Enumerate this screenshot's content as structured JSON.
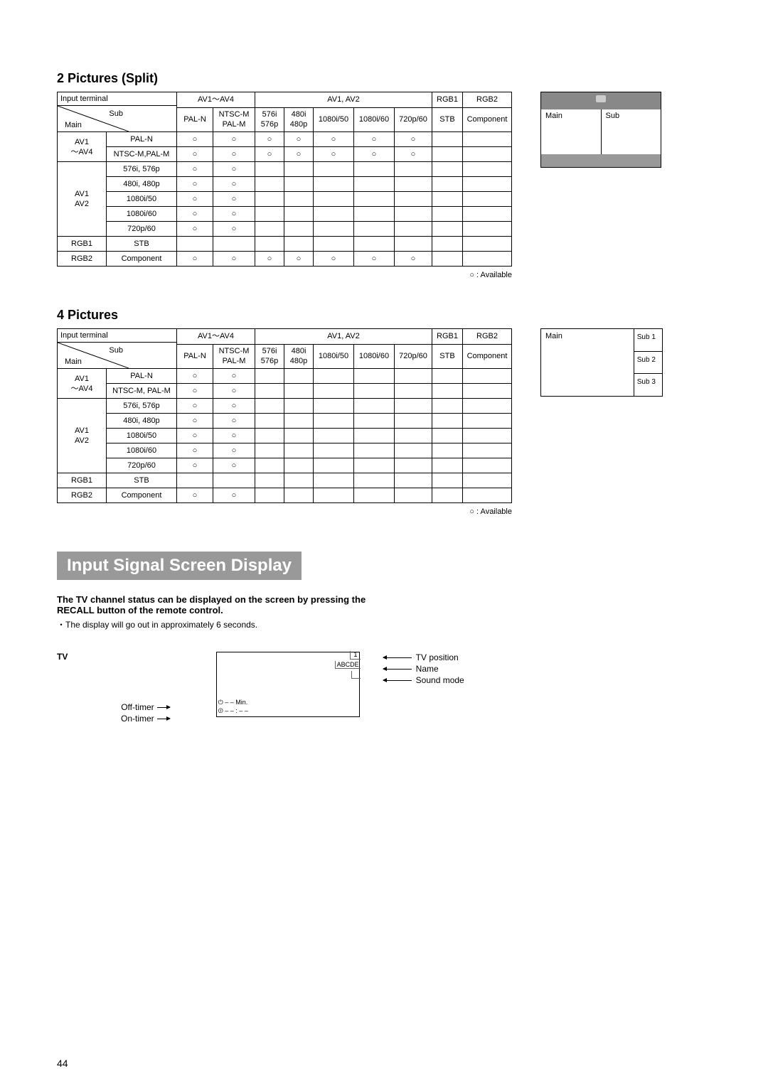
{
  "sectionA": {
    "title": "2 Pictures (Split)",
    "cols": {
      "input_terminal": "Input terminal",
      "group1": "AV1～AV4",
      "group2": "AV1, AV2",
      "rgb1": "RGB1",
      "rgb2": "RGB2",
      "sub": "Sub",
      "main": "Main",
      "pal_n": "PAL-N",
      "ntsc": "NTSC-M\nPAL-M",
      "c576i": "576i\n576p",
      "c480i": "480i\n480p",
      "c1080i50": "1080i/50",
      "c1080i60": "1080i/60",
      "c720p60": "720p/60",
      "stb": "STB",
      "component": "Component"
    },
    "rowGroups": {
      "g1": "AV1\n～AV4",
      "g2": "AV1\nAV2",
      "rgb1": "RGB1",
      "rgb2": "RGB2"
    },
    "rows": [
      {
        "label": "PAL-N",
        "cells": [
          "○",
          "○",
          "○",
          "○",
          "○",
          "○",
          "○",
          "",
          ""
        ]
      },
      {
        "label": "NTSC-M,PAL-M",
        "cells": [
          "○",
          "○",
          "○",
          "○",
          "○",
          "○",
          "○",
          "",
          ""
        ]
      },
      {
        "label": "576i, 576p",
        "cells": [
          "○",
          "○",
          "",
          "",
          "",
          "",
          "",
          "",
          ""
        ]
      },
      {
        "label": "480i, 480p",
        "cells": [
          "○",
          "○",
          "",
          "",
          "",
          "",
          "",
          "",
          ""
        ]
      },
      {
        "label": "1080i/50",
        "cells": [
          "○",
          "○",
          "",
          "",
          "",
          "",
          "",
          "",
          ""
        ]
      },
      {
        "label": "1080i/60",
        "cells": [
          "○",
          "○",
          "",
          "",
          "",
          "",
          "",
          "",
          ""
        ]
      },
      {
        "label": "720p/60",
        "cells": [
          "○",
          "○",
          "",
          "",
          "",
          "",
          "",
          "",
          ""
        ]
      },
      {
        "label": "STB",
        "cells": [
          "",
          "",
          "",
          "",
          "",
          "",
          "",
          "",
          ""
        ]
      },
      {
        "label": "Component",
        "cells": [
          "○",
          "○",
          "○",
          "○",
          "○",
          "○",
          "○",
          "",
          ""
        ]
      }
    ],
    "legend": "○ : Available",
    "dia": {
      "main": "Main",
      "sub": "Sub"
    }
  },
  "sectionB": {
    "title": "4 Pictures",
    "cols": {
      "input_terminal": "Input terminal",
      "group1": "AV1～AV4",
      "group2": "AV1, AV2",
      "rgb1": "RGB1",
      "rgb2": "RGB2",
      "sub": "Sub",
      "main": "Main",
      "pal_n": "PAL-N",
      "ntsc": "NTSC-M\nPAL-M",
      "c576i": "576i\n576p",
      "c480i": "480i\n480p",
      "c1080i50": "1080i/50",
      "c1080i60": "1080i/60",
      "c720p60": "720p/60",
      "stb": "STB",
      "component": "Component"
    },
    "rowGroups": {
      "g1": "AV1\n～AV4",
      "g2": "AV1\nAV2",
      "rgb1": "RGB1",
      "rgb2": "RGB2"
    },
    "rows": [
      {
        "label": "PAL-N",
        "cells": [
          "○",
          "○",
          "",
          "",
          "",
          "",
          "",
          "",
          ""
        ]
      },
      {
        "label": "NTSC-M, PAL-M",
        "cells": [
          "○",
          "○",
          "",
          "",
          "",
          "",
          "",
          "",
          ""
        ]
      },
      {
        "label": "576i, 576p",
        "cells": [
          "○",
          "○",
          "",
          "",
          "",
          "",
          "",
          "",
          ""
        ]
      },
      {
        "label": "480i, 480p",
        "cells": [
          "○",
          "○",
          "",
          "",
          "",
          "",
          "",
          "",
          ""
        ]
      },
      {
        "label": "1080i/50",
        "cells": [
          "○",
          "○",
          "",
          "",
          "",
          "",
          "",
          "",
          ""
        ]
      },
      {
        "label": "1080i/60",
        "cells": [
          "○",
          "○",
          "",
          "",
          "",
          "",
          "",
          "",
          ""
        ]
      },
      {
        "label": "720p/60",
        "cells": [
          "○",
          "○",
          "",
          "",
          "",
          "",
          "",
          "",
          ""
        ]
      },
      {
        "label": "STB",
        "cells": [
          "",
          "",
          "",
          "",
          "",
          "",
          "",
          "",
          ""
        ]
      },
      {
        "label": "Component",
        "cells": [
          "○",
          "○",
          "",
          "",
          "",
          "",
          "",
          "",
          ""
        ]
      }
    ],
    "legend": "○ : Available",
    "dia": {
      "main": "Main",
      "sub1": "Sub 1",
      "sub2": "Sub 2",
      "sub3": "Sub 3"
    }
  },
  "banner": "Input Signal Screen Display",
  "intro": {
    "bold": "The TV channel status can be displayed on the screen by pressing the RECALL button of the remote control.",
    "note": "・The display will go out in approximately 6 seconds."
  },
  "osd": {
    "tv": "TV",
    "pos": "1",
    "name": "ABCDE",
    "offTimerLabel": "Off-timer",
    "onTimerLabel": "On-timer",
    "offTimerVal": "– – Min.",
    "onTimerVal": "– – : – –",
    "right1": "TV position",
    "right2": "Name",
    "right3": "Sound mode"
  },
  "pageNum": "44"
}
